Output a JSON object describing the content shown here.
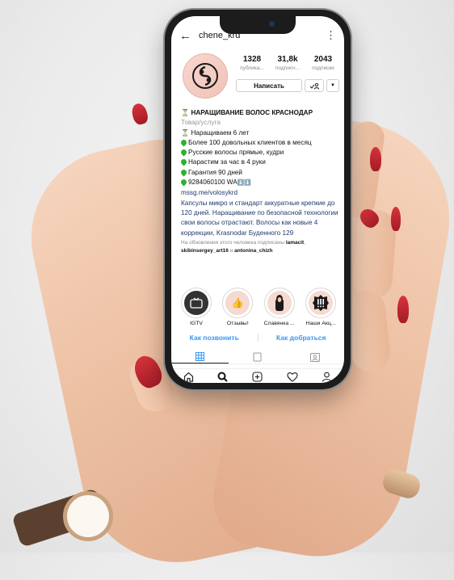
{
  "colors": {
    "accent": "#3797f0",
    "nail": "#c0242d",
    "skin": "#eec2a5"
  },
  "header": {
    "back_icon": "arrow-left-icon",
    "username": "chene_krd",
    "menu_icon": "more-vertical-icon"
  },
  "stats": [
    {
      "value": "1328",
      "label": "публика..."
    },
    {
      "value": "31,8k",
      "label": "подписч..."
    },
    {
      "value": "2043",
      "label": "подписки"
    }
  ],
  "buttons": {
    "message": "Написать",
    "follow_icon": "person-check-icon",
    "more_icon": "chevron-down-icon"
  },
  "bio": {
    "name": "НАРАЩИВАНИЕ ВОЛОС КРАСНОДАР",
    "category": "Товар/услуга",
    "lines": [
      "Наращиваем 6 лет",
      "Более 100 довольных клиентов в месяц",
      "Русские волосы прямые, кудри",
      "Нарастим за час в 4 руки",
      "Гарантия 90 дней",
      "9284060100 WA"
    ],
    "link": "mssg.me/volosykrd",
    "description": "Капсулы микро и стандарт аккуратные крепкие до 120 дней.  Наращивание по безопасной технологии свои волосы отрастают. Волосы как новые 4 коррекции, Krasnodar Буденного 129",
    "followed_prefix": "На обновления этого человека подписаны",
    "followed_user1": "lamacit",
    "followed_user2": "skibinsergey_art16",
    "followed_and": "и",
    "followed_user3": "antonina_chizh"
  },
  "highlights": [
    {
      "label": "IGTV"
    },
    {
      "label": "Отзывы!"
    },
    {
      "label": "Славянка ..."
    },
    {
      "label": "Наши Акц..."
    }
  ],
  "contact": {
    "call": "Как позвонить",
    "directions": "Как добраться"
  },
  "tabs": [
    "grid-icon",
    "igtv-tab-icon",
    "tagged-icon"
  ],
  "nav": [
    "home-icon",
    "search-icon",
    "add-post-icon",
    "heart-icon",
    "profile-icon"
  ]
}
